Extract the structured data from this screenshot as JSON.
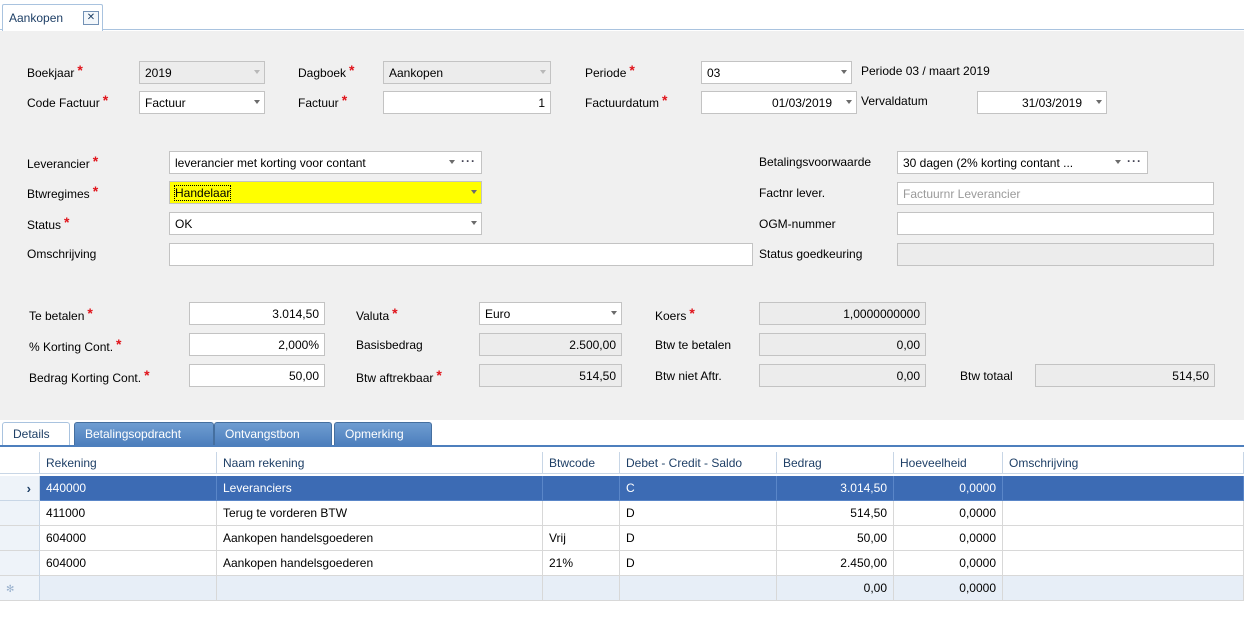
{
  "doc_tab": {
    "title": "Aankopen",
    "close": "✕"
  },
  "header": {
    "boekjaar": {
      "label": "Boekjaar",
      "value": "2019"
    },
    "dagboek": {
      "label": "Dagboek",
      "value": "Aankopen"
    },
    "periode": {
      "label": "Periode",
      "value": "03",
      "info": "Periode 03 / maart 2019"
    },
    "code_factuur": {
      "label": "Code Factuur",
      "value": "Factuur"
    },
    "factuur": {
      "label": "Factuur",
      "value": "1"
    },
    "factuurdatum": {
      "label": "Factuurdatum",
      "value": "01/03/2019"
    },
    "vervaldatum": {
      "label": "Vervaldatum",
      "value": "31/03/2019"
    }
  },
  "supplier": {
    "leverancier": {
      "label": "Leverancier",
      "value": "leverancier met korting voor contant"
    },
    "btwregimes": {
      "label": "Btwregimes",
      "value": "Handelaar"
    },
    "status": {
      "label": "Status",
      "value": "OK"
    },
    "omschrijving": {
      "label": "Omschrijving",
      "value": ""
    },
    "betalingsvoorwaarde": {
      "label": "Betalingsvoorwaarde",
      "value": "30 dagen (2% korting contant ..."
    },
    "factnr_lever": {
      "label": "Factnr lever.",
      "placeholder": "Factuurnr Leverancier"
    },
    "ogm_nummer": {
      "label": "OGM-nummer",
      "value": ""
    },
    "status_goedkeuring": {
      "label": "Status goedkeuring",
      "value": ""
    }
  },
  "amounts": {
    "te_betalen": {
      "label": "Te betalen",
      "value": "3.014,50"
    },
    "korting_pct": {
      "label": "% Korting Cont.",
      "value": "2,000%"
    },
    "bedrag_korting": {
      "label": "Bedrag Korting Cont.",
      "value": "50,00"
    },
    "valuta": {
      "label": "Valuta",
      "value": "Euro"
    },
    "basisbedrag": {
      "label": "Basisbedrag",
      "value": "2.500,00"
    },
    "btw_aftrekbaar": {
      "label": "Btw aftrekbaar",
      "value": "514,50"
    },
    "koers": {
      "label": "Koers",
      "value": "1,0000000000"
    },
    "btw_te_betalen": {
      "label": "Btw te betalen",
      "value": "0,00"
    },
    "btw_niet_aftr": {
      "label": "Btw niet Aftr.",
      "value": "0,00"
    },
    "btw_totaal": {
      "label": "Btw totaal",
      "value": "514,50"
    }
  },
  "tabs": [
    {
      "label": "Details"
    },
    {
      "label": "Betalingsopdracht"
    },
    {
      "label": "Ontvangstbon"
    },
    {
      "label": "Opmerking"
    }
  ],
  "grid": {
    "columns": [
      "Rekening",
      "Naam rekening",
      "Btwcode",
      "Debet - Credit - Saldo",
      "Bedrag",
      "Hoeveelheid",
      "Omschrijving"
    ],
    "rows": [
      {
        "rekening": "440000",
        "naam": "Leveranciers",
        "btwcode": "",
        "dcs": "C",
        "bedrag": "3.014,50",
        "hoeveelheid": "0,0000",
        "omschrijving": ""
      },
      {
        "rekening": "411000",
        "naam": "Terug te vorderen BTW",
        "btwcode": "",
        "dcs": "D",
        "bedrag": "514,50",
        "hoeveelheid": "0,0000",
        "omschrijving": ""
      },
      {
        "rekening": "604000",
        "naam": "Aankopen handelsgoederen",
        "btwcode": "Vrij",
        "dcs": "D",
        "bedrag": "50,00",
        "hoeveelheid": "0,0000",
        "omschrijving": ""
      },
      {
        "rekening": "604000",
        "naam": "Aankopen handelsgoederen",
        "btwcode": "21%",
        "dcs": "D",
        "bedrag": "2.450,00",
        "hoeveelheid": "0,0000",
        "omschrijving": ""
      }
    ],
    "new_row": {
      "bedrag": "0,00",
      "hoeveelheid": "0,0000"
    }
  },
  "colors": {
    "accent": "#4d7fbd",
    "selected_row": "#3c6bb4",
    "required": "#e0131a",
    "highlight": "#ffff00"
  }
}
